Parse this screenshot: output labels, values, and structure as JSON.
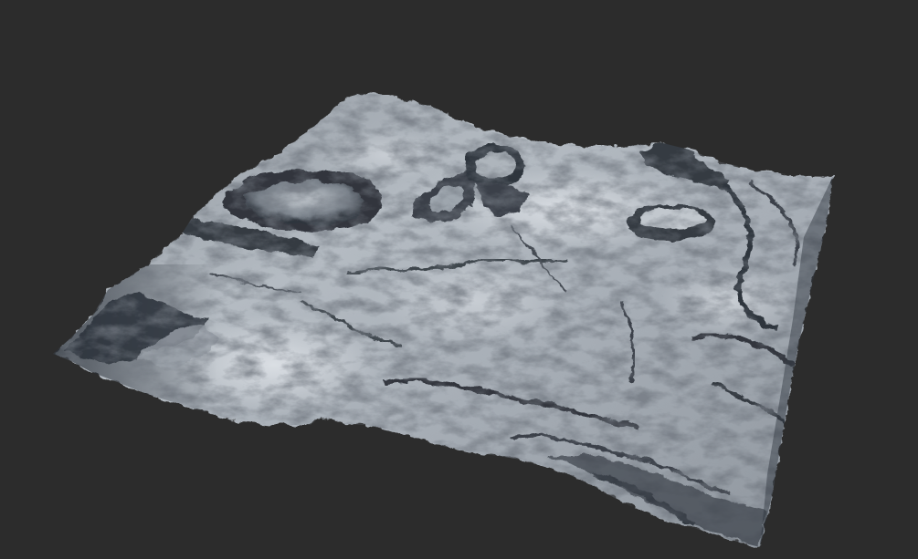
{
  "scene": {
    "background_color": "#2c2c2c",
    "subject": "terrain-heightmap-render",
    "surface_color": "#a9b0b8",
    "highlight_color": "#dde2e7",
    "shadow_color": "#272c33"
  }
}
